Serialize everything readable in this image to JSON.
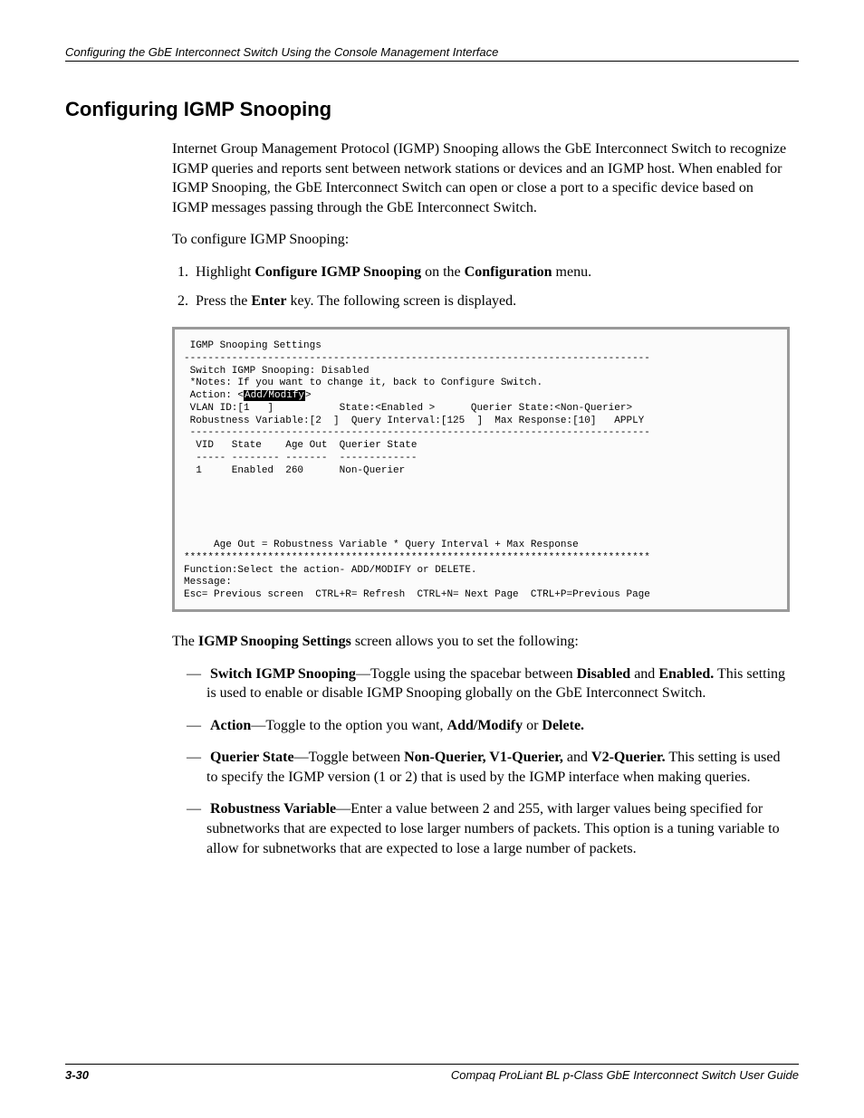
{
  "header": {
    "running_head": "Configuring the GbE Interconnect Switch Using the Console Management Interface"
  },
  "section": {
    "title": "Configuring IGMP Snooping",
    "intro": "Internet Group Management Protocol (IGMP) Snooping allows the GbE Interconnect Switch to recognize IGMP queries and reports sent between network stations or devices and an IGMP host. When enabled for IGMP Snooping, the GbE Interconnect Switch can open or close a port to a specific device based on IGMP messages passing through the GbE Interconnect Switch.",
    "lead_in": "To configure IGMP Snooping:",
    "steps": {
      "s1_pre": "Highlight ",
      "s1_b1": "Configure IGMP Snooping",
      "s1_mid": " on the ",
      "s1_b2": "Configuration",
      "s1_post": " menu.",
      "s2_pre": "Press the ",
      "s2_b1": "Enter",
      "s2_post": " key. The following screen is displayed."
    }
  },
  "console": {
    "l01": " IGMP Snooping Settings",
    "l02": "------------------------------------------------------------------------------",
    "l03": " Switch IGMP Snooping: Disabled",
    "l04": " *Notes: If you want to change it, back to Configure Switch.",
    "l05a": " Action: <",
    "l05b": "Add/Modify",
    "l05c": ">",
    "l06": " VLAN ID:[1   ]           State:<Enabled >      Querier State:<Non-Querier>",
    "l07": " Robustness Variable:[2  ]  Query Interval:[125  ]  Max Response:[10]   APPLY",
    "l08": " -----------------------------------------------------------------------------",
    "l09": "  VID   State    Age Out  Querier State",
    "l10": "  ----- -------- -------  -------------",
    "l11": "  1     Enabled  260      Non-Querier",
    "l12": "",
    "l13": "",
    "l14": "",
    "l15": "",
    "l16": "",
    "l17": "     Age Out = Robustness Variable * Query Interval + Max Response",
    "l18": "******************************************************************************",
    "l19": "Function:Select the action- ADD/MODIFY or DELETE.",
    "l20": "Message:",
    "l21": "Esc= Previous screen  CTRL+R= Refresh  CTRL+N= Next Page  CTRL+P=Previous Page"
  },
  "after": {
    "pre": "The ",
    "b1": "IGMP Snooping Settings",
    "post": " screen allows you to set the following:"
  },
  "bullets": {
    "b1_t1": "Switch IGMP Snooping",
    "b1_mid1": "—Toggle using the spacebar between ",
    "b1_t2": "Disabled",
    "b1_mid2": " and ",
    "b1_t3": "Enabled.",
    "b1_post": " This setting is used to enable or disable IGMP Snooping globally on the GbE Interconnect Switch.",
    "b2_t1": "Action",
    "b2_mid1": "—Toggle to the option you want, ",
    "b2_t2": "Add/Modify",
    "b2_mid2": " or ",
    "b2_t3": "Delete.",
    "b3_t1": "Querier State",
    "b3_mid1": "—Toggle between ",
    "b3_t2": "Non-Querier, V1-Querier,",
    "b3_mid2": " and ",
    "b3_t3": "V2-Querier.",
    "b3_post": " This setting is used to specify the IGMP version (1 or 2) that is used by the IGMP interface when making queries.",
    "b4_t1": "Robustness Variable",
    "b4_post": "—Enter a value between 2 and 255, with larger values being specified for subnetworks that are expected to lose larger numbers of packets. This option is a tuning variable to allow for subnetworks that are expected to lose a large number of packets."
  },
  "footer": {
    "page": "3-30",
    "book": "Compaq ProLiant BL p-Class GbE Interconnect Switch User Guide"
  }
}
